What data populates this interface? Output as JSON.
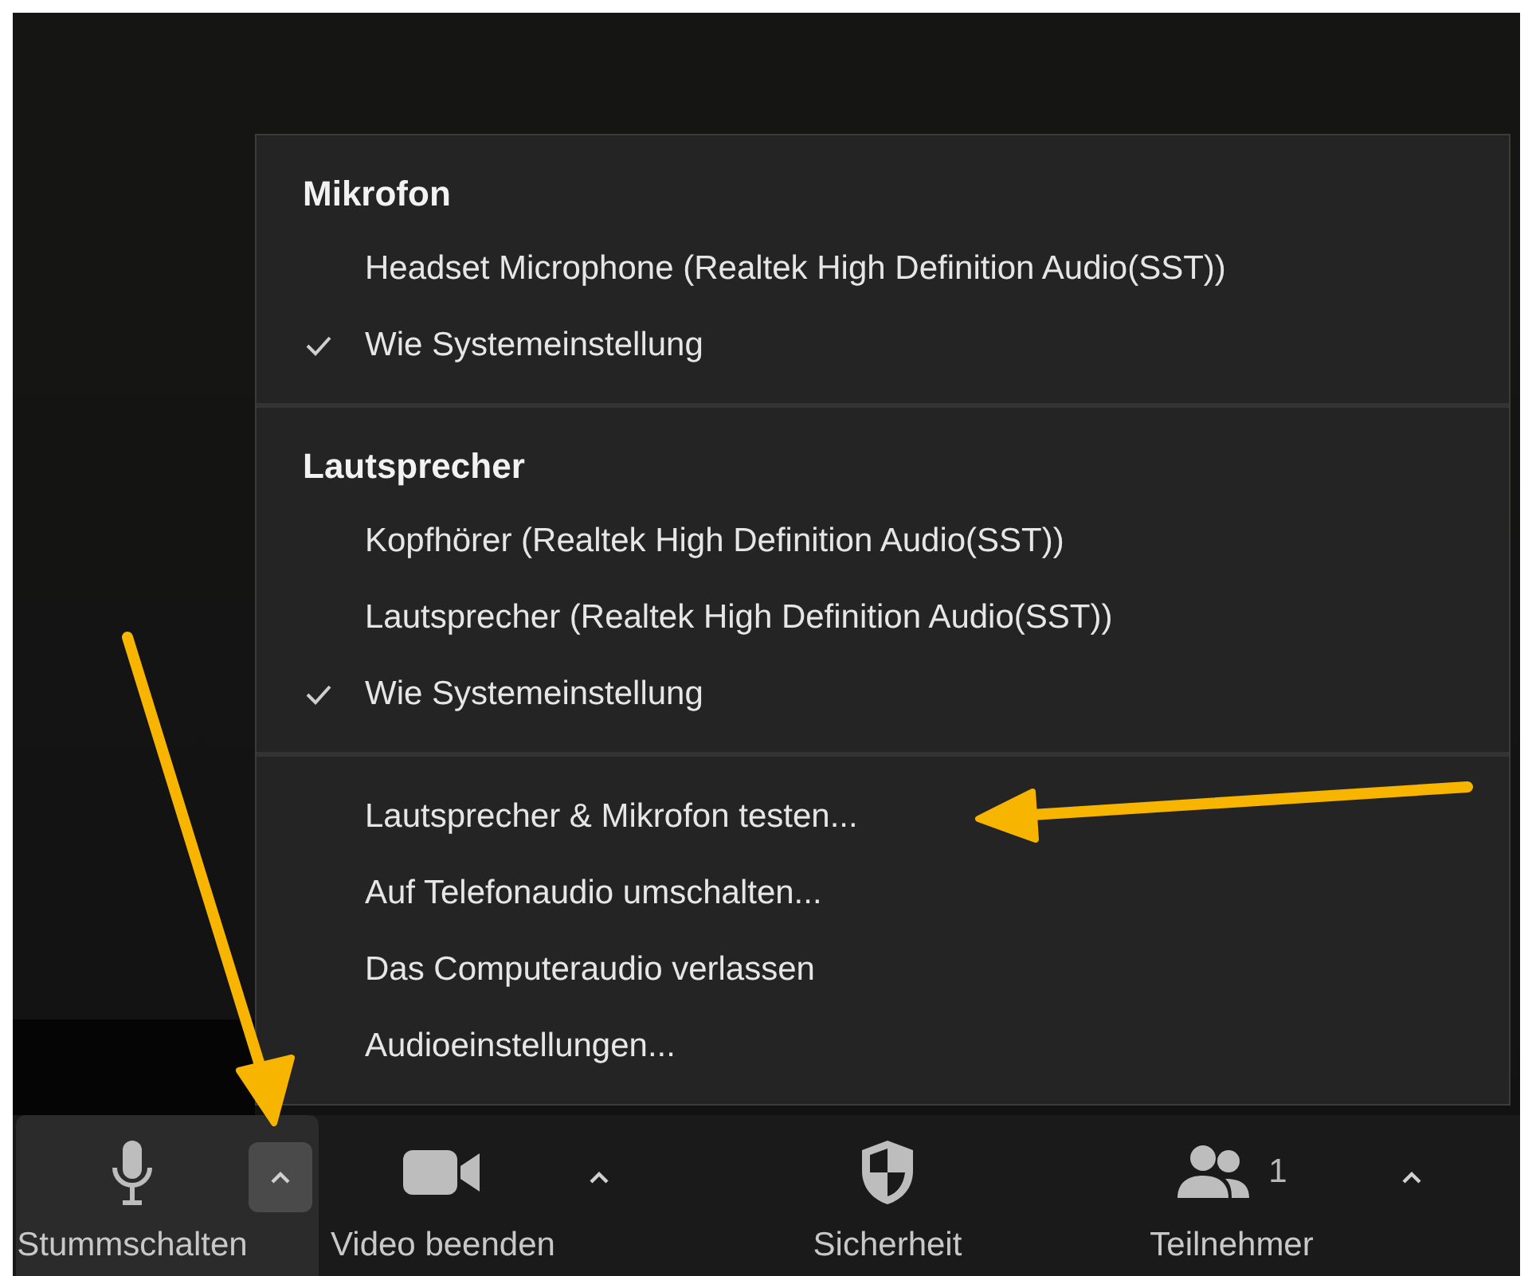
{
  "audio_menu": {
    "sections": [
      {
        "title": "Mikrofon",
        "items": [
          {
            "label": "Headset Microphone (Realtek High Definition Audio(SST))",
            "checked": false
          },
          {
            "label": "Wie Systemeinstellung",
            "checked": true
          }
        ]
      },
      {
        "title": "Lautsprecher",
        "items": [
          {
            "label": "Kopfhörer (Realtek High Definition Audio(SST))",
            "checked": false
          },
          {
            "label": "Lautsprecher (Realtek High Definition Audio(SST))",
            "checked": false
          },
          {
            "label": "Wie Systemeinstellung",
            "checked": true
          }
        ]
      },
      {
        "items": [
          {
            "label": "Lautsprecher & Mikrofon testen...",
            "checked": false
          },
          {
            "label": "Auf Telefonaudio umschalten...",
            "checked": false
          },
          {
            "label": "Das Computeraudio verlassen",
            "checked": false
          },
          {
            "label": "Audioeinstellungen...",
            "checked": false
          }
        ]
      }
    ]
  },
  "toolbar": [
    {
      "kind": "mic",
      "label": "Stummschalten",
      "selected": true,
      "caret": true,
      "menu_open": true
    },
    {
      "kind": "video",
      "label": "Video beenden",
      "selected": false,
      "caret": true,
      "menu_open": false
    },
    {
      "kind": "security",
      "label": "Sicherheit",
      "selected": false,
      "caret": false
    },
    {
      "kind": "participants",
      "label": "Teilnehmer",
      "count": "1",
      "selected": false,
      "caret": true,
      "menu_open": false
    }
  ]
}
